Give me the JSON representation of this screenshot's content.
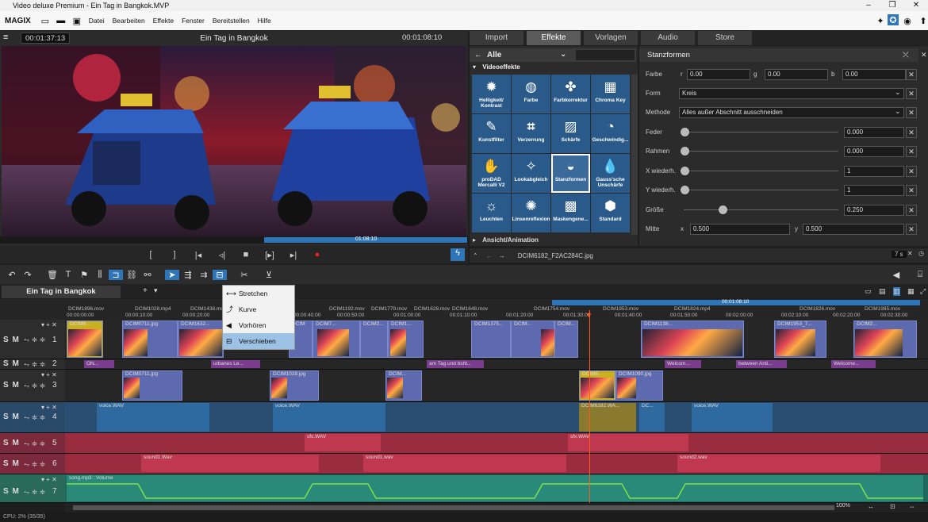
{
  "window": {
    "title": "Video deluxe Premium - Ein Tag in Bangkok.MVP"
  },
  "menubar": {
    "brand": "MAGIX",
    "items": [
      "Datei",
      "Bearbeiten",
      "Effekte",
      "Fenster",
      "Bereitstellen",
      "Hilfe"
    ]
  },
  "preview": {
    "timecode_left": "00:01:37:13",
    "title": "Ein Tag in Bangkok",
    "timecode_right": "00:01:08:10",
    "scrub_time": "01:08:10"
  },
  "tabs": [
    "Import",
    "Effekte",
    "Vorlagen",
    "Audio",
    "Store"
  ],
  "active_tab": "Effekte",
  "fx": {
    "filter": "Alle",
    "section": "Videoeffekte",
    "footer": "Ansicht/Animation",
    "items": [
      "Helligkeit/ Kontrast",
      "Farbe",
      "Farbkorrektur",
      "Chroma Key",
      "Kunstfilter",
      "Verzerrung",
      "Schärfe",
      "Geschwindig...",
      "proDAD Mercalli V2",
      "Lookabgleich",
      "Stanzformen",
      "Gauss'sche Unschärfe",
      "Leuchten",
      "Linsenreflexion",
      "Maskengene...",
      "Standard"
    ]
  },
  "stanz": {
    "title": "Stanzformen",
    "farbe": {
      "label": "Farbe",
      "r_label": "r",
      "r": "0.00",
      "g_label": "g",
      "g": "0.00",
      "b_label": "b",
      "b": "0.00"
    },
    "form": {
      "label": "Form",
      "value": "Kreis"
    },
    "methode": {
      "label": "Methode",
      "value": "Alles außer Abschnitt ausschneiden"
    },
    "feder": {
      "label": "Feder",
      "value": "0.000"
    },
    "rahmen": {
      "label": "Rahmen",
      "value": "0.000"
    },
    "xw": {
      "label": "X wiederh.",
      "value": "1"
    },
    "yw": {
      "label": "Y wiederh.",
      "value": "1"
    },
    "groesse": {
      "label": "Größe",
      "value": "0.250"
    },
    "mitte": {
      "label": "Mitte",
      "x_label": "x",
      "x": "0.500",
      "y_label": "y",
      "y": "0.500"
    }
  },
  "pathbar": {
    "file": "DCIM6182_F2AC284C.jpg",
    "duration": "7 s"
  },
  "timeline": {
    "project_tab": "Ein Tag in Bangkok",
    "ruler_time": "00:01:08:10",
    "ruler_labels": [
      "DCIM1896.mov",
      "DCIM1028.mp4",
      "DCIM1438.mov",
      "DCIM1192.mov",
      "DCIM1779.mov",
      "DCIM1628.mov",
      "DCIM1648.mov",
      "DCIM1754.mov",
      "DCIM1953.mov",
      "DCIM1824.mp4",
      "DCIM1826.mov",
      "DCIM1985.mov"
    ],
    "ruler_times": [
      "00:00:00:00",
      "00:00:10:00",
      "00:00:20:00",
      "00:00:40:00",
      "00:00:50:00",
      "00:01:00:00",
      "00:01:10:00",
      "00:01:20:00",
      "00:01:30:00",
      "00:01:40:00",
      "00:01:50:00",
      "00:02:00:00",
      "00:02:10:00",
      "00:02:20:00",
      "00:02:30:00"
    ],
    "track_sm": "S M",
    "tracks": [
      {
        "num": "1",
        "clips": [
          "DCIM6...",
          "DCIM0711.jpg",
          "DCIM1632...",
          "DCIM",
          "DCIM7...",
          "DCIM2...",
          "DCIM1...",
          "DCIM1375...",
          "DCIM...",
          "DCIM...",
          "DCIM1138...",
          "DCIM1953_7...",
          "DCIM2..."
        ]
      },
      {
        "num": "2",
        "clips": [
          "ON...",
          "urbanes Le...",
          "am Tag und bsht...",
          "Welcom...",
          "between  Anti...",
          "Welcome..."
        ]
      },
      {
        "num": "3",
        "clips": [
          "DCIM0711.jpg",
          "DCIM1028.jpg",
          "DCIM...",
          "DCIM6...",
          "DCIM1090.jpg"
        ]
      },
      {
        "num": "4",
        "clips": [
          "voice.WAV",
          "voice.WAV",
          "DCIM6182.WA...",
          "DC...",
          "voice.WAV"
        ]
      },
      {
        "num": "5",
        "clips": [
          "sfx.WAV",
          "sfx.WAV"
        ]
      },
      {
        "num": "6",
        "clips": [
          "sound1.Wav",
          "sound1.wav",
          "sound2.wav"
        ]
      },
      {
        "num": "7",
        "clips": [
          "song.mp3 : Volume"
        ]
      }
    ],
    "zoom": "100%"
  },
  "context_menu": {
    "items": [
      "Stretchen",
      "Kurve",
      "Vorhören",
      "Verschieben"
    ],
    "highlighted": "Verschieben"
  },
  "status": {
    "cpu": "CPU: 2% (35/35)"
  }
}
